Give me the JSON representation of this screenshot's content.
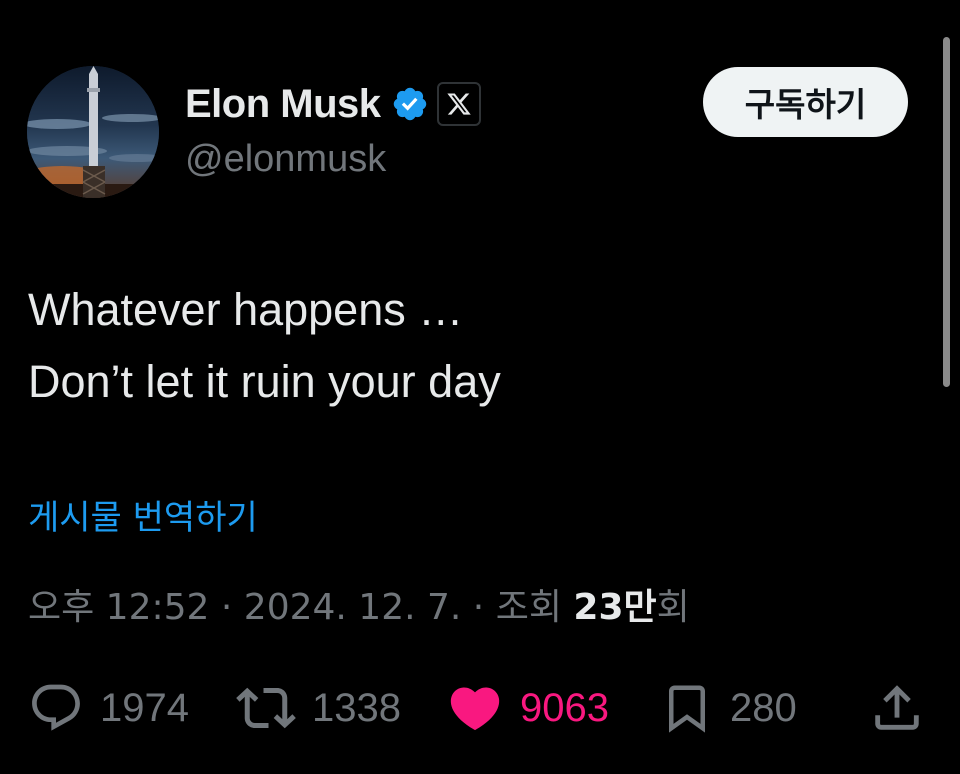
{
  "author": {
    "display_name": "Elon Musk",
    "handle": "@elonmusk",
    "verified_icon": "verified-badge-icon",
    "affiliate_glyph": "𝕏"
  },
  "subscribe_button": {
    "label": "구독하기"
  },
  "tweet": {
    "lines": [
      "Whatever happens …",
      "Don’t let it ruin your day"
    ]
  },
  "translate_link": "게시물 번역하기",
  "meta": {
    "time": "오후 12:52",
    "separator": "·",
    "date": "2024. 12. 7.",
    "views_label": "조회",
    "views_count": "23만",
    "views_suffix": "회"
  },
  "actions": {
    "reply": {
      "icon": "reply-icon",
      "count": "1974"
    },
    "repost": {
      "icon": "repost-icon",
      "count": "1338"
    },
    "like": {
      "icon": "heart-icon",
      "count": "9063",
      "liked": true
    },
    "bookmark": {
      "icon": "bookmark-icon",
      "count": "280"
    },
    "share": {
      "icon": "share-icon"
    }
  },
  "colors": {
    "background": "#000000",
    "primary_text": "#e7e9ea",
    "secondary_text": "#71767b",
    "link": "#1d9bf0",
    "like": "#f91880",
    "verified": "#1d9bf0"
  }
}
